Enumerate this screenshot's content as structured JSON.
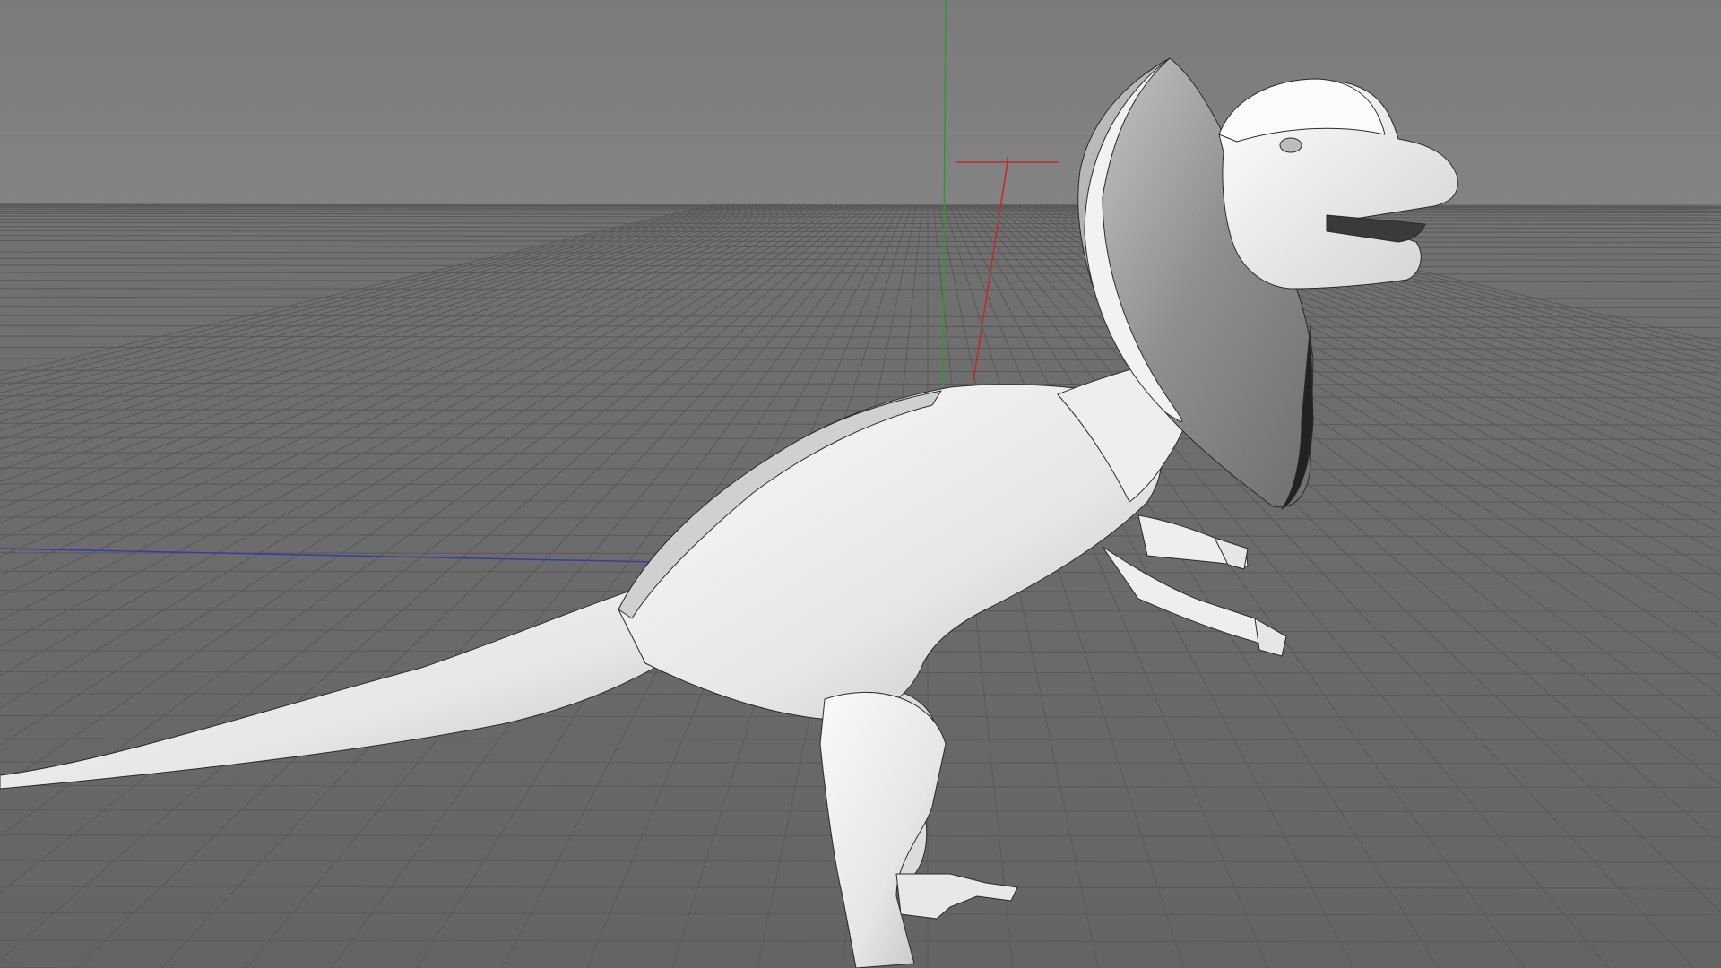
{
  "app": {
    "view": "perspective-viewport"
  },
  "viewport": {
    "background_color": "#7a7a7a",
    "sky_color": "#7d7d7d",
    "floor_color": "#6b6b6b",
    "grid_color": "#5e5e5e",
    "horizon_color": "#8e8e8e",
    "axis_colors": {
      "x": "#c22a2a",
      "y": "#2e9a2e",
      "z": "#3a3aaa"
    },
    "model": {
      "name": "dilophosaurus-mesh",
      "display_mode": "gouraud-shading-lines",
      "surface_color": "#efefef",
      "wire_color": "#2a2a2a"
    },
    "null_object": {
      "icon": "null-object-marker"
    }
  }
}
